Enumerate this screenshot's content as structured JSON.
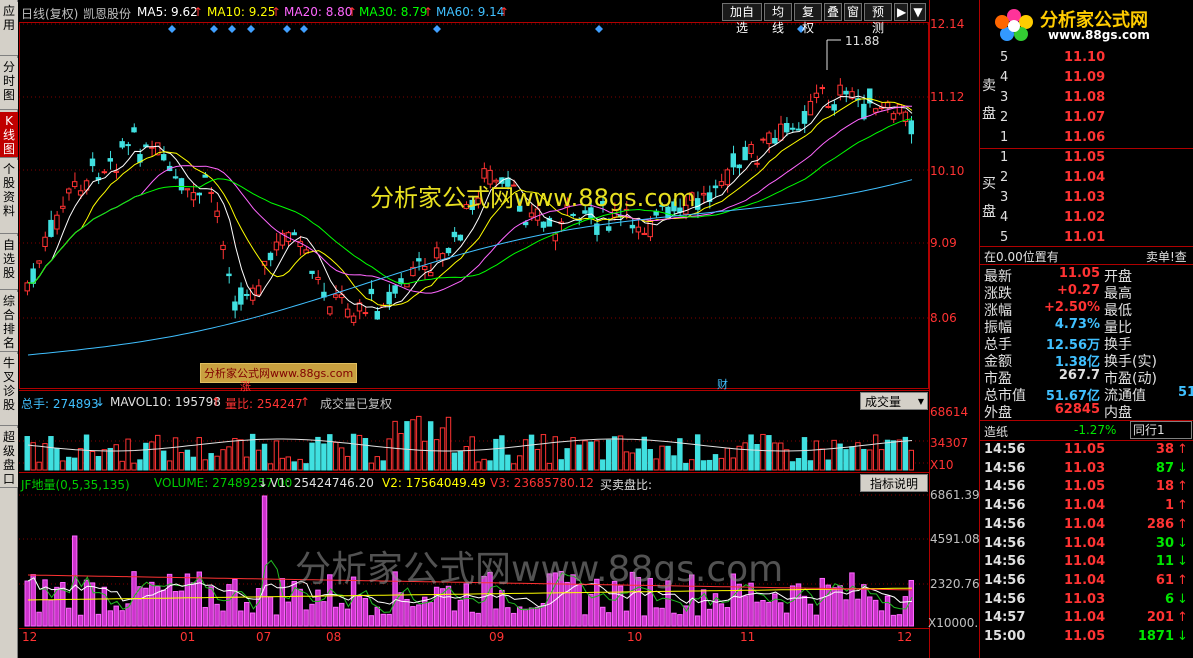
{
  "left_tabs": [
    {
      "label": "应用",
      "active": false
    },
    {
      "label": "分时图",
      "active": false
    },
    {
      "label": "K线图",
      "active": true
    },
    {
      "label": "个股资料",
      "active": false
    },
    {
      "label": "自选股",
      "active": false
    },
    {
      "label": "综合排名",
      "active": false
    },
    {
      "label": "牛叉诊股",
      "active": false
    },
    {
      "label": "超级盘口",
      "active": false
    }
  ],
  "header": {
    "title": "日线(复权)",
    "stock": "凯恩股份",
    "ma5": "MA5: 9.62",
    "ma10": "MA10: 9.25",
    "ma20": "MA20: 8.80",
    "ma30": "MA30: 8.79",
    "ma60": "MA60: 9.14",
    "colors": {
      "ma5": "#ffffff",
      "ma10": "#ffff00",
      "ma20": "#ff66ff",
      "ma30": "#00ff00",
      "ma60": "#40c0ff"
    }
  },
  "toolbar": {
    "add_watch": "加自选",
    "ma_line": "均线",
    "restore": "复权",
    "overlay": "叠",
    "window": "窗",
    "forecast": "预测",
    "more": "▶"
  },
  "price_axis": [
    "12.14",
    "11.12",
    "10.10",
    "9.09",
    "8.06"
  ],
  "price_high_label": "11.88",
  "watermark_main": "分析家公式网www.88gs.com",
  "watermark_small": "分析家公式网www.88gs.com",
  "watermark_bottom": "分析家公式网www.88gs.com",
  "event_marks": [
    "涨",
    "财"
  ],
  "volume_panel": {
    "total_label": "总手: 274893",
    "mavol": "MAVOL10: 195798",
    "ratio": "量比: 254247",
    "note": "成交量已复权",
    "dropdown": "成交量",
    "axis": [
      "68614",
      "34307",
      "X10"
    ]
  },
  "indicator_panel": {
    "name": "JF地量(0,5,35,135)",
    "volume": "VOLUME: 27489257.00",
    "v1": "V1: 25424746.20",
    "v2": "V2: 17564049.49",
    "v3": "V3: 23685780.12",
    "trade_ratio": "买卖盘比:",
    "button": "指标说明",
    "axis": [
      "6861.39",
      "4591.08",
      "2320.76",
      "X10000.0"
    ]
  },
  "x_axis": [
    "12",
    "01",
    "07",
    "08",
    "09",
    "10",
    "11",
    "12"
  ],
  "logo": {
    "text": "分析家公式网",
    "url": "www.88gs.com"
  },
  "order_book": {
    "sell_label": "卖盘",
    "buy_label": "买盘",
    "sells": [
      {
        "level": "5",
        "price": "11.10"
      },
      {
        "level": "4",
        "price": "11.09"
      },
      {
        "level": "3",
        "price": "11.08"
      },
      {
        "level": "2",
        "price": "11.07"
      },
      {
        "level": "1",
        "price": "11.06"
      }
    ],
    "buys": [
      {
        "level": "1",
        "price": "11.05"
      },
      {
        "level": "2",
        "price": "11.04"
      },
      {
        "level": "3",
        "price": "11.03"
      },
      {
        "level": "4",
        "price": "11.02"
      },
      {
        "level": "5",
        "price": "11.01"
      }
    ]
  },
  "position_bar": {
    "left": "在0.00位置有",
    "right": "卖单!查"
  },
  "quote": [
    {
      "l1": "最新",
      "v1": "11.05",
      "l2": "开盘",
      "c": "red"
    },
    {
      "l1": "涨跌",
      "v1": "+0.27",
      "l2": "最高",
      "c": "red"
    },
    {
      "l1": "涨幅",
      "v1": "+2.50%",
      "l2": "最低",
      "c": "red"
    },
    {
      "l1": "振幅",
      "v1": "4.73%",
      "l2": "量比",
      "c": "cyan"
    },
    {
      "l1": "总手",
      "v1": "12.56万",
      "l2": "换手",
      "c": "cyan"
    },
    {
      "l1": "金额",
      "v1": "1.38亿",
      "l2": "换手(实)",
      "c": "cyan"
    },
    {
      "l1": "市盈",
      "v1": "267.7",
      "l2": "市盈(动)",
      "c": "white"
    },
    {
      "l1": "总市值",
      "v1": "51.67亿",
      "l2": "流通值",
      "v2": "51",
      "c": "cyan"
    },
    {
      "l1": "外盘",
      "v1": "62845",
      "l2": "内盘",
      "c": "red"
    }
  ],
  "ticker_header": {
    "name": "造纸",
    "change": "-1.27%",
    "tab": "同行1"
  },
  "ticks": [
    {
      "time": "14:56",
      "price": "11.05",
      "vol": "38",
      "dir": "up"
    },
    {
      "time": "14:56",
      "price": "11.03",
      "vol": "87",
      "dir": "down"
    },
    {
      "time": "14:56",
      "price": "11.05",
      "vol": "18",
      "dir": "up"
    },
    {
      "time": "14:56",
      "price": "11.04",
      "vol": "1",
      "dir": "up"
    },
    {
      "time": "14:56",
      "price": "11.04",
      "vol": "286",
      "dir": "up"
    },
    {
      "time": "14:56",
      "price": "11.04",
      "vol": "30",
      "dir": "down"
    },
    {
      "time": "14:56",
      "price": "11.04",
      "vol": "11",
      "dir": "down"
    },
    {
      "time": "14:56",
      "price": "11.04",
      "vol": "61",
      "dir": "up"
    },
    {
      "time": "14:56",
      "price": "11.03",
      "vol": "6",
      "dir": "down"
    },
    {
      "time": "14:57",
      "price": "11.04",
      "vol": "201",
      "dir": "up"
    },
    {
      "time": "15:00",
      "price": "11.05",
      "vol": "1871",
      "dir": "down"
    }
  ]
}
